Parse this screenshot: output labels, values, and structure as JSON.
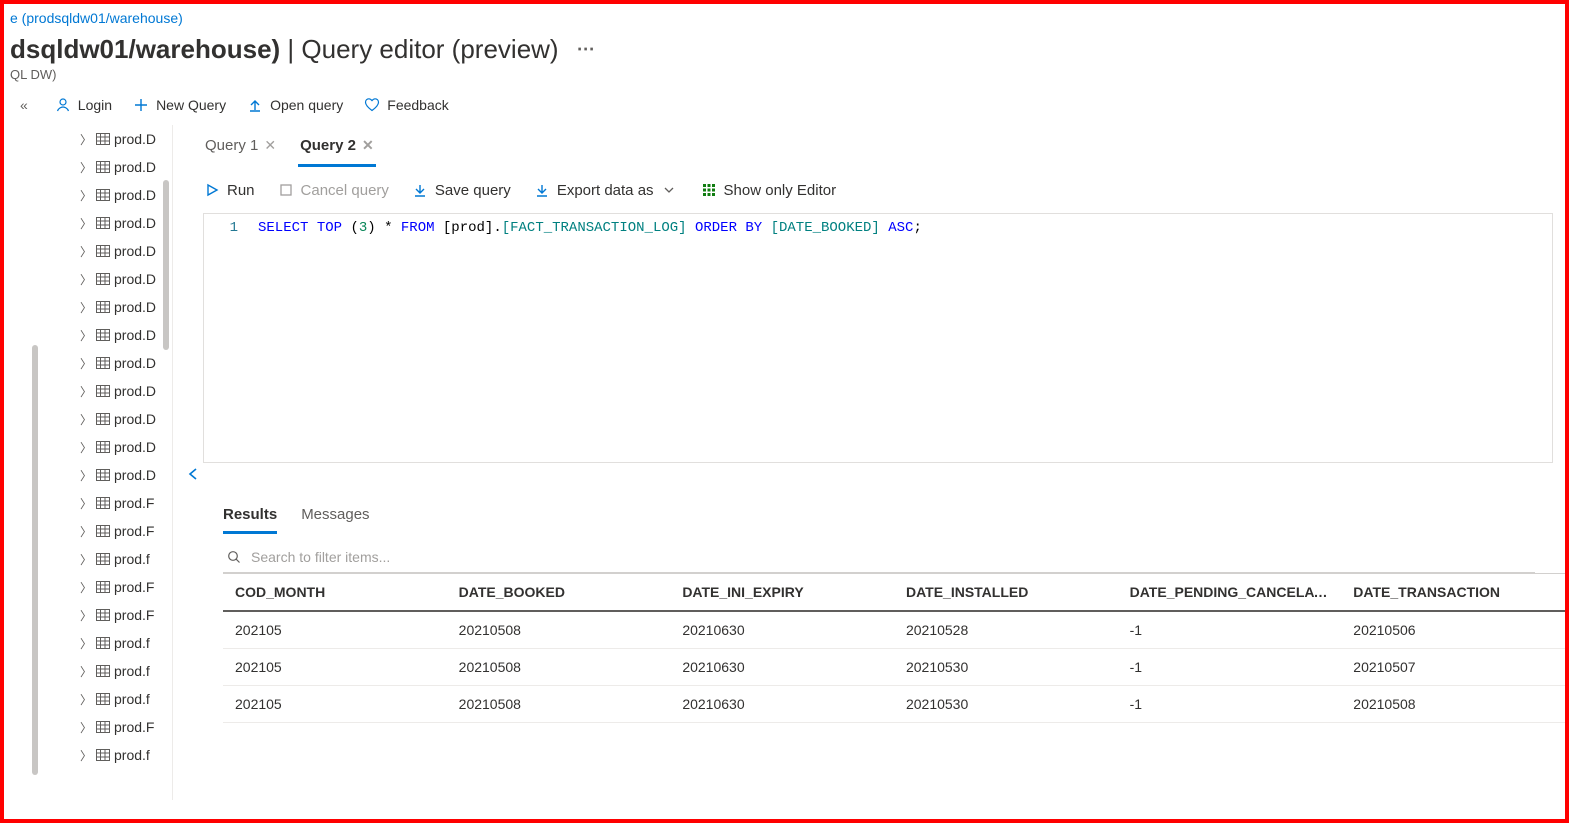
{
  "breadcrumb": "e (prodsqldw01/warehouse)",
  "title_prefix": "dsqldw01/warehouse)",
  "title_sep": " | ",
  "title_suffix": "Query editor (preview)",
  "subtitle": "QL DW)",
  "toolbar": {
    "login": "Login",
    "new_query": "New Query",
    "open_query": "Open query",
    "feedback": "Feedback"
  },
  "tree_items": [
    "prod.D",
    "prod.D",
    "prod.D",
    "prod.D",
    "prod.D",
    "prod.D",
    "prod.D",
    "prod.D",
    "prod.D",
    "prod.D",
    "prod.D",
    "prod.D",
    "prod.D",
    "prod.F",
    "prod.F",
    "prod.f",
    "prod.F",
    "prod.F",
    "prod.f",
    "prod.f",
    "prod.f",
    "prod.F",
    "prod.f"
  ],
  "query_tabs": [
    {
      "label": "Query 1",
      "active": false
    },
    {
      "label": "Query 2",
      "active": true
    }
  ],
  "query_toolbar": {
    "run": "Run",
    "cancel": "Cancel query",
    "save": "Save query",
    "export": "Export data as",
    "show_only": "Show only Editor"
  },
  "code": {
    "line_no": "1",
    "tokens": {
      "select": "SELECT",
      "top": "TOP",
      "lp": "(",
      "n": "3",
      "rp": ")",
      "star": "*",
      "from": "FROM",
      "schema": "[prod].",
      "table": "[FACT_TRANSACTION_LOG]",
      "orderby": "ORDER BY",
      "col": "[DATE_BOOKED]",
      "asc": "ASC",
      "semi": ";"
    }
  },
  "result_tabs": {
    "results": "Results",
    "messages": "Messages"
  },
  "search_placeholder": "Search to filter items...",
  "results": {
    "columns": [
      "COD_MONTH",
      "DATE_BOOKED",
      "DATE_INI_EXPIRY",
      "DATE_INSTALLED",
      "DATE_PENDING_CANCELATIO…",
      "DATE_TRANSACTION"
    ],
    "rows": [
      [
        "202105",
        "20210508",
        "20210630",
        "20210528",
        "-1",
        "20210506"
      ],
      [
        "202105",
        "20210508",
        "20210630",
        "20210530",
        "-1",
        "20210507"
      ],
      [
        "202105",
        "20210508",
        "20210630",
        "20210530",
        "-1",
        "20210508"
      ]
    ]
  }
}
